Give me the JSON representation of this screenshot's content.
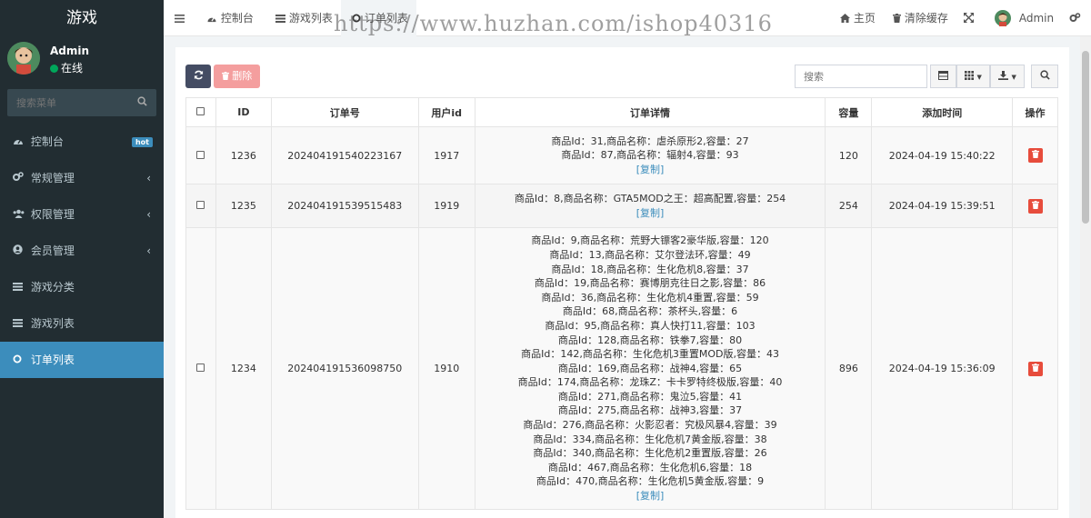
{
  "app": {
    "title": "游戏"
  },
  "user": {
    "name": "Admin",
    "status": "在线"
  },
  "sidebar": {
    "search_placeholder": "搜索菜单",
    "items": [
      {
        "label": "控制台",
        "icon": "dashboard-icon",
        "badge": "hot"
      },
      {
        "label": "常规管理",
        "icon": "cogs-icon"
      },
      {
        "label": "权限管理",
        "icon": "group-icon"
      },
      {
        "label": "会员管理",
        "icon": "user-circle-icon"
      },
      {
        "label": "游戏分类",
        "icon": "list-icon"
      },
      {
        "label": "游戏列表",
        "icon": "list-icon"
      },
      {
        "label": "订单列表",
        "icon": "circle-icon"
      }
    ]
  },
  "topbar": {
    "tabs": [
      {
        "label": "控制台"
      },
      {
        "label": "游戏列表"
      },
      {
        "label": "订单列表"
      }
    ],
    "home": "主页",
    "clear_cache": "清除缓存",
    "admin": "Admin",
    "watermark": "https://www.huzhan.com/ishop40316"
  },
  "toolbar": {
    "delete_label": "删除",
    "search_placeholder": "搜索"
  },
  "table": {
    "headers": [
      "ID",
      "订单号",
      "用户id",
      "订单详情",
      "容量",
      "添加时间",
      "操作"
    ],
    "copy_label": "[复制]",
    "rows": [
      {
        "id": "1236",
        "order_no": "202404191540223167",
        "user_id": "1917",
        "details": [
          "商品Id：31,商品名称：虐杀原形2,容量：27",
          "商品Id：87,商品名称：辐射4,容量：93"
        ],
        "capacity": "120",
        "time": "2024-04-19 15:40:22"
      },
      {
        "id": "1235",
        "order_no": "202404191539515483",
        "user_id": "1919",
        "details": [
          "商品Id：8,商品名称：GTA5MOD之王：超高配置,容量：254"
        ],
        "capacity": "254",
        "time": "2024-04-19 15:39:51"
      },
      {
        "id": "1234",
        "order_no": "202404191536098750",
        "user_id": "1910",
        "details": [
          "商品Id：9,商品名称：荒野大镖客2豪华版,容量：120",
          "商品Id：13,商品名称：艾尔登法环,容量：49",
          "商品Id：18,商品名称：生化危机8,容量：37",
          "商品Id：19,商品名称：赛博朋克往日之影,容量：86",
          "商品Id：36,商品名称：生化危机4重置,容量：59",
          "商品Id：68,商品名称：茶杯头,容量：6",
          "商品Id：95,商品名称：真人快打11,容量：103",
          "商品Id：128,商品名称：铁拳7,容量：80",
          "商品Id：142,商品名称：生化危机3重置MOD版,容量：43",
          "商品Id：169,商品名称：战神4,容量：65",
          "商品Id：174,商品名称：龙珠Z：卡卡罗特终极版,容量：40",
          "商品Id：271,商品名称：鬼泣5,容量：41",
          "商品Id：275,商品名称：战神3,容量：37",
          "商品Id：276,商品名称：火影忍者：究极风暴4,容量：39",
          "商品Id：334,商品名称：生化危机7黄金版,容量：38",
          "商品Id：340,商品名称：生化危机2重置版,容量：26",
          "商品Id：467,商品名称：生化危机6,容量：18",
          "商品Id：470,商品名称：生化危机5黄金版,容量：9"
        ],
        "capacity": "896",
        "time": "2024-04-19 15:36:09"
      }
    ]
  }
}
